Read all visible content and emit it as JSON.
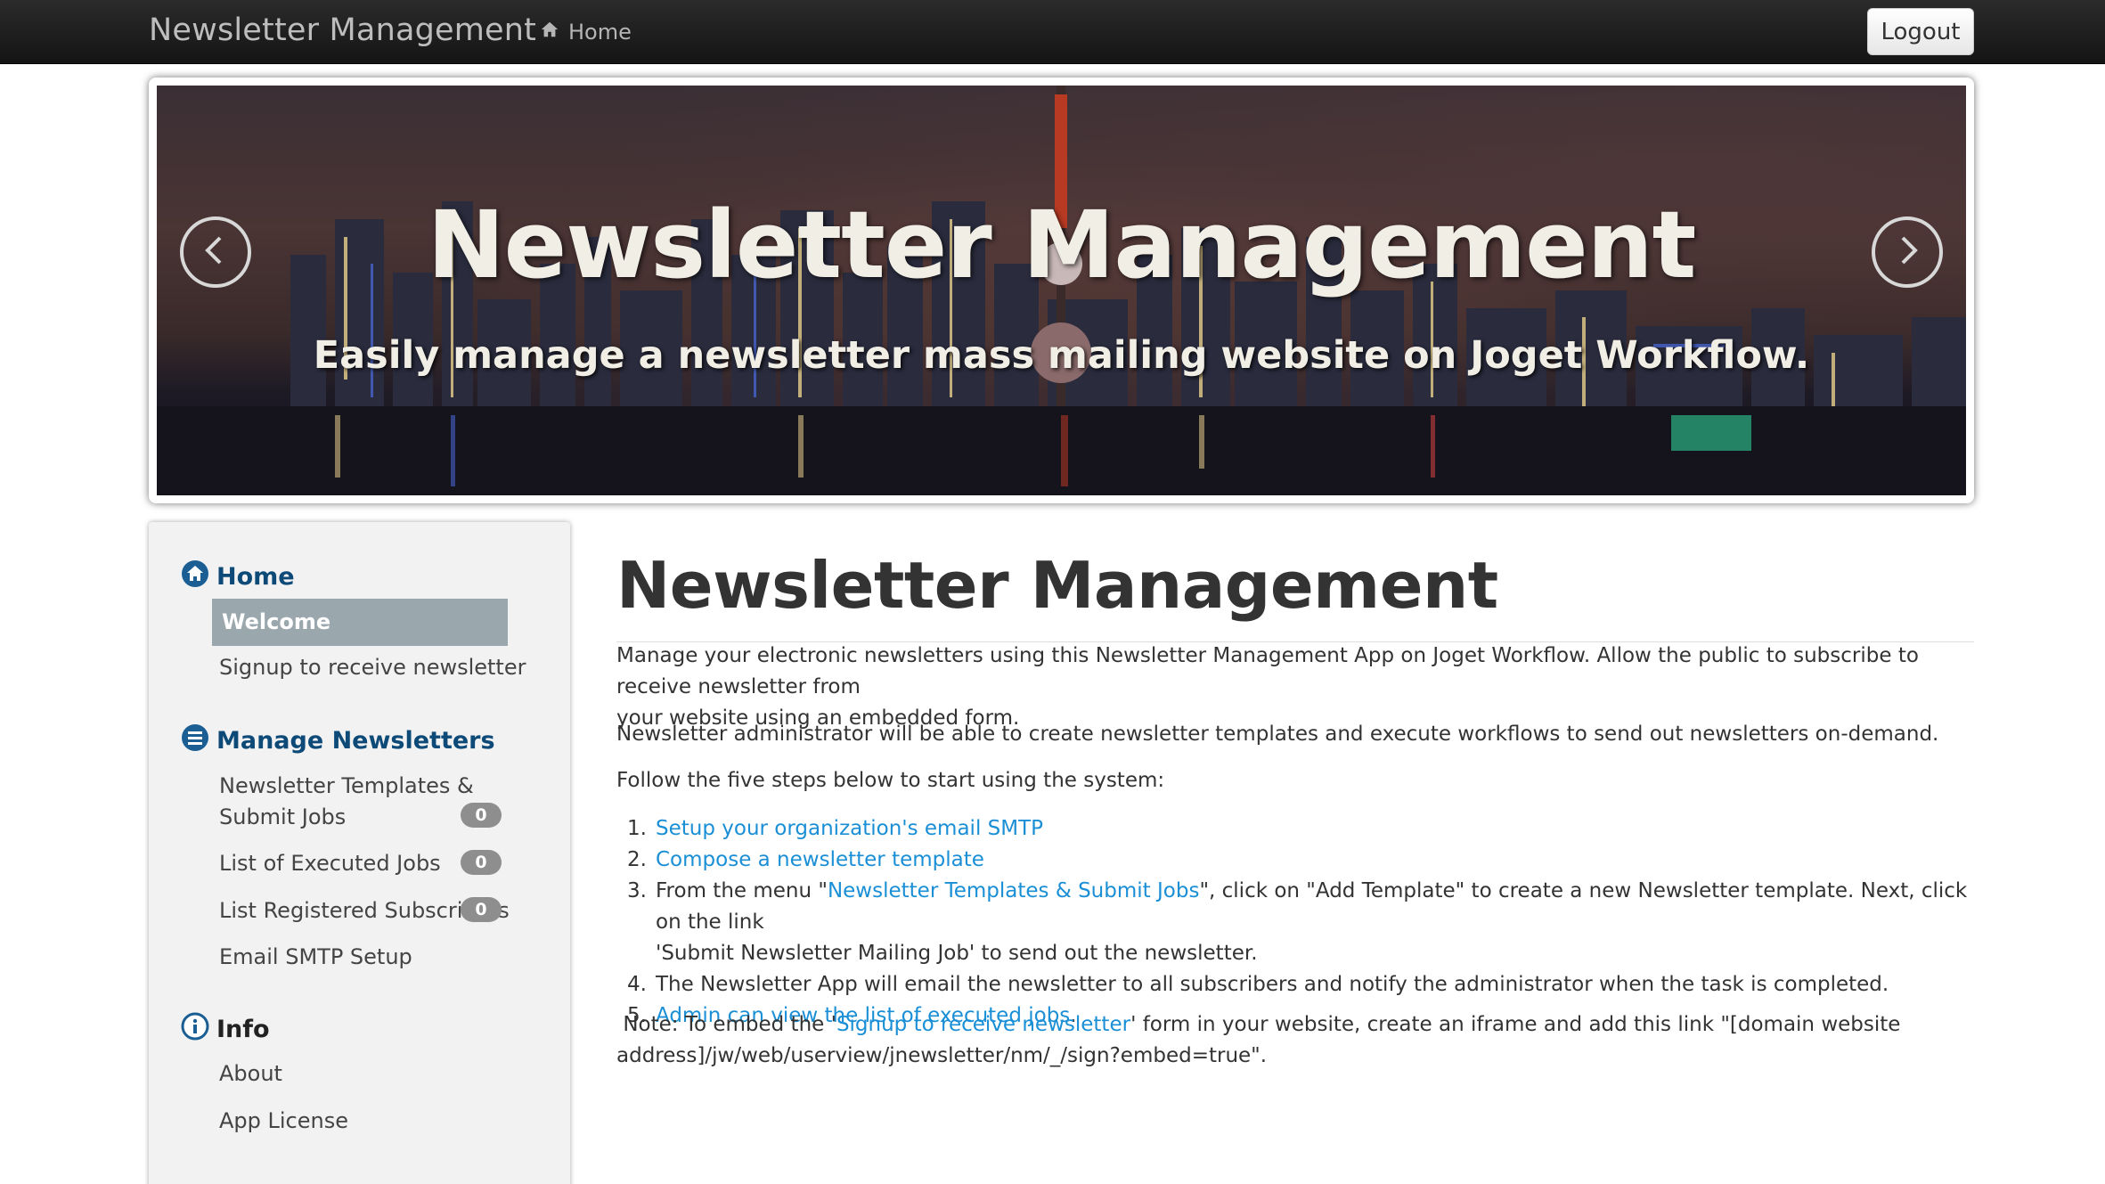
{
  "navbar": {
    "brand": "Newsletter Management",
    "home_label": "Home",
    "logout_label": "Logout"
  },
  "banner": {
    "title": "Newsletter Management",
    "subtitle": "Easily manage a newsletter mass mailing website on Joget Workflow.",
    "prev_icon": "chevron-left-circle-icon",
    "next_icon": "chevron-right-circle-icon"
  },
  "sidebar": {
    "sections": [
      {
        "title": "Home",
        "icon": "home-icon",
        "items": [
          {
            "label": "Welcome",
            "active": true
          },
          {
            "label": "Signup to receive newsletter"
          }
        ]
      },
      {
        "title": "Manage Newsletters",
        "icon": "list-icon",
        "items": [
          {
            "label_line1": "Newsletter Templates &",
            "label_line2": "Submit Jobs",
            "badge": "0"
          },
          {
            "label": "List of Executed Jobs",
            "badge": "0"
          },
          {
            "label": "List Registered Subscribers",
            "badge": "0"
          },
          {
            "label": "Email SMTP Setup"
          }
        ]
      },
      {
        "title": "Info",
        "icon": "info-icon",
        "items": [
          {
            "label": "About"
          },
          {
            "label": "App License"
          }
        ]
      }
    ]
  },
  "main": {
    "title": "Newsletter Management",
    "intro_line1": "Manage your electronic newsletters using this Newsletter Management App on Joget Workflow. Allow the public to subscribe to receive newsletter from",
    "intro_line2": "your website using an embedded form.",
    "admin_para": "Newsletter administrator will be able to create newsletter templates and execute workflows to send out newsletters on-demand.",
    "steps_intro": "Follow the five steps below to start using the system:",
    "steps": [
      {
        "num": "1.",
        "link": "Setup your organization's email SMTP"
      },
      {
        "num": "2.",
        "link": "Compose a newsletter template"
      },
      {
        "num": "3.",
        "pre": "From the menu \"",
        "link": "Newsletter Templates & Submit Jobs",
        "post": "\", click on \"Add Template\" to create a new Newsletter template. Next, click on the link",
        "line2": "'Submit Newsletter Mailing Job' to send out the newsletter."
      },
      {
        "num": "4.",
        "text": "The Newsletter App will email the newsletter to all subscribers and notify the administrator when the task is completed."
      },
      {
        "num": "5.",
        "link": "Admin can view the list of executed jobs",
        "post": "."
      }
    ],
    "note": {
      "pre": " Note: To embed the '",
      "link": "Signup to receive newsletter",
      "post": "' form in your website, create an iframe and add this link \"[domain website",
      "line2": "address]/jw/web/userview/jnewsletter/nm/_/sign?embed=true\"."
    }
  },
  "colors": {
    "navbar_bg": "#1a1a1a",
    "sidebar_heading": "#0d4a78",
    "active_item_bg": "#9aa7ad",
    "link": "#1a8fd6",
    "badge_bg": "#8e8e8e"
  }
}
